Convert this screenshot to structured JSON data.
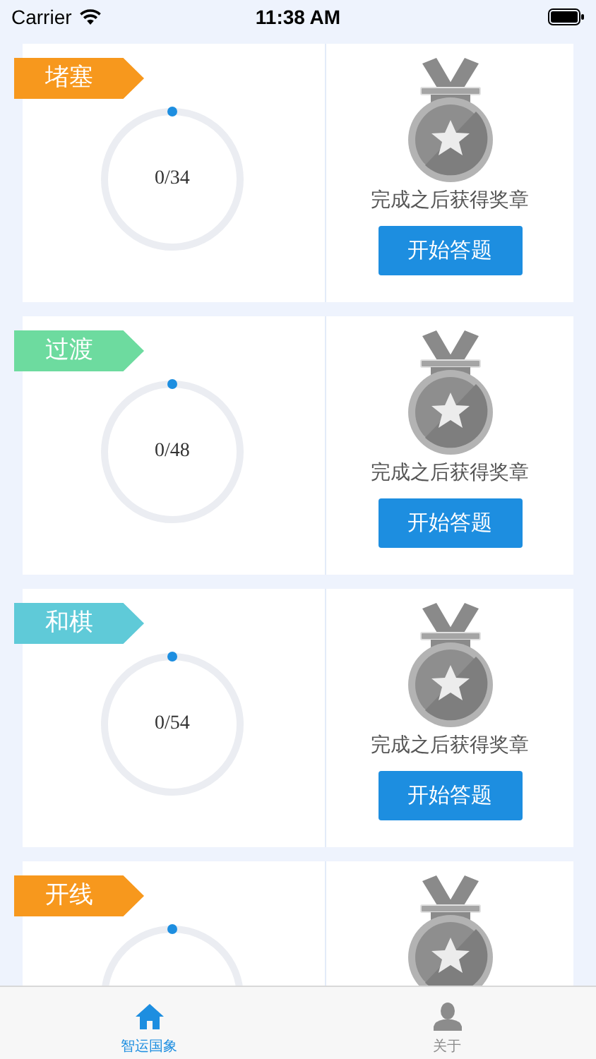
{
  "status_bar": {
    "carrier": "Carrier",
    "time": "11:38 AM"
  },
  "levels": [
    {
      "tag": "堵塞",
      "color": "#f7981d",
      "level": 0,
      "count": "0/34",
      "caption": "完成之后获得奖章",
      "button": "开始答题"
    },
    {
      "tag": "过渡",
      "color": "#6ddb9f",
      "level": 0,
      "count": "0/48",
      "caption": "完成之后获得奖章",
      "button": "开始答题"
    },
    {
      "tag": "和棋",
      "color": "#5fcad8",
      "level": 0,
      "count": "0/54",
      "caption": "完成之后获得奖章",
      "button": "开始答题"
    },
    {
      "tag": "开线",
      "color": "#f7981d",
      "level": 0
    }
  ],
  "tab_bar": [
    {
      "label": "智运国象",
      "kind": "home",
      "selected": true
    },
    {
      "label": "关于",
      "kind": "person",
      "selected": false
    }
  ]
}
